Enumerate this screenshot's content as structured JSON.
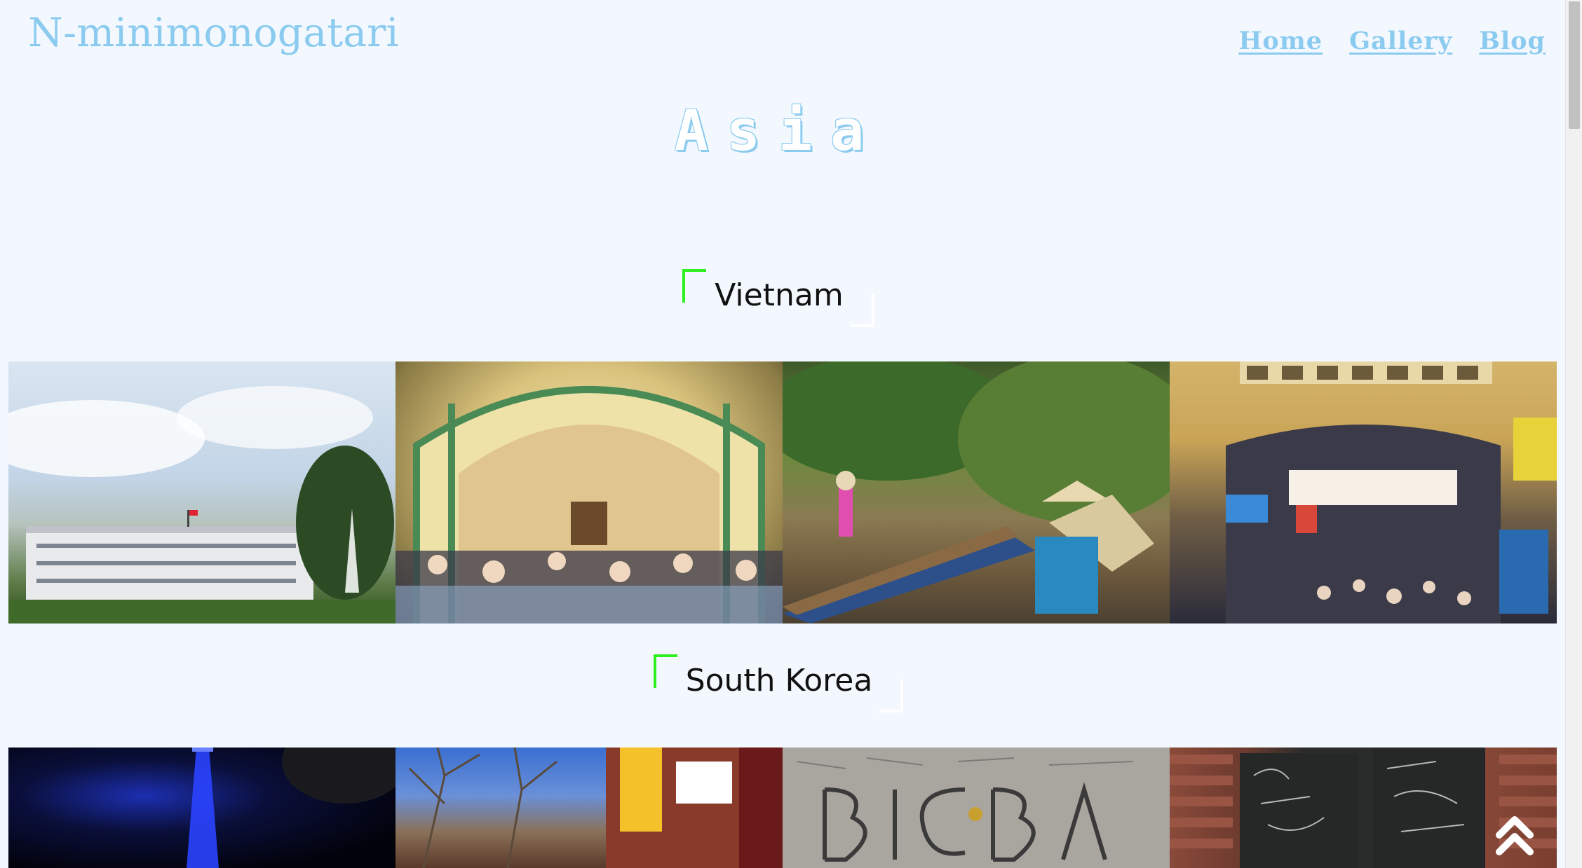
{
  "site": {
    "title": "N-minimonogatari"
  },
  "nav": {
    "items": [
      {
        "label": "Home"
      },
      {
        "label": "Gallery"
      },
      {
        "label": "Blog"
      }
    ]
  },
  "page": {
    "heading": "Asia"
  },
  "sections": [
    {
      "title": "Vietnam",
      "photos": [
        {
          "icon": "palace-photo"
        },
        {
          "icon": "post-office-hall-photo"
        },
        {
          "icon": "river-boats-photo"
        },
        {
          "icon": "market-entrance-photo"
        }
      ]
    },
    {
      "title": "South Korea",
      "photos": [
        {
          "icon": "tower-night-photo"
        },
        {
          "icon": "street-signs-photo"
        },
        {
          "icon": "graffiti-wall-photo"
        },
        {
          "icon": "chalkboard-doors-photo"
        }
      ]
    }
  ],
  "colors": {
    "background": "#f3f8fe",
    "accent": "#8ccbf0",
    "bracket_green": "#2ef01e"
  },
  "back_to_top": {
    "icon": "double-chevron-up-icon"
  }
}
